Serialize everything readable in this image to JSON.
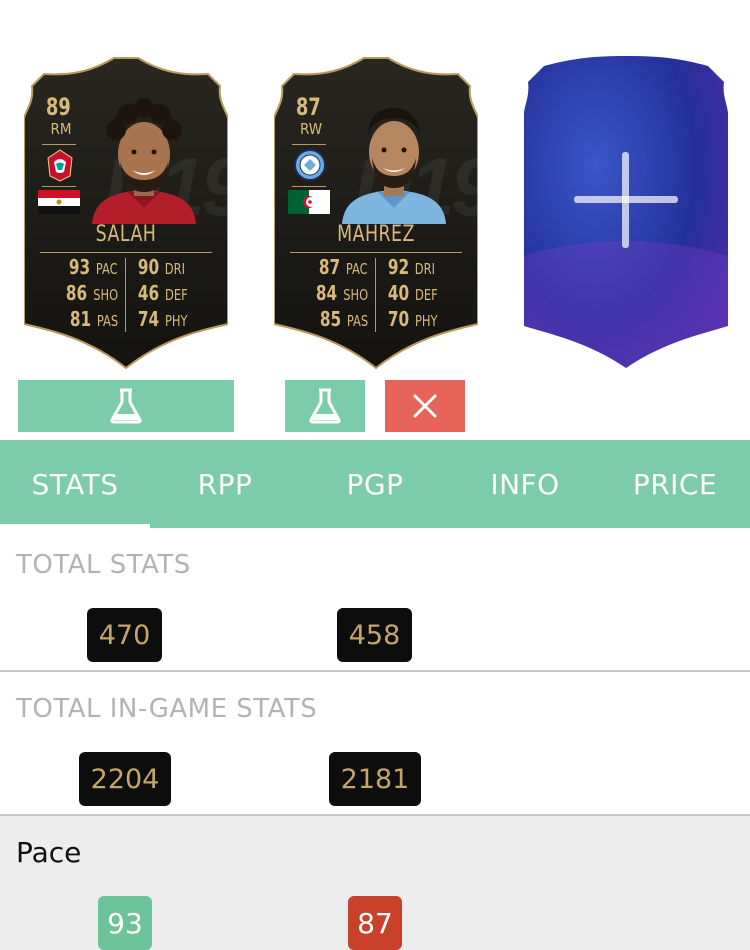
{
  "players": [
    {
      "rating": "89",
      "position": "RM",
      "name": "SALAH",
      "club_icon": "liverpool-crest-icon",
      "flag_icon": "egypt-flag-icon",
      "stats_left": [
        {
          "value": "93",
          "key": "PAC"
        },
        {
          "value": "86",
          "key": "SHO"
        },
        {
          "value": "81",
          "key": "PAS"
        }
      ],
      "stats_right": [
        {
          "value": "90",
          "key": "DRI"
        },
        {
          "value": "46",
          "key": "DEF"
        },
        {
          "value": "74",
          "key": "PHY"
        }
      ]
    },
    {
      "rating": "87",
      "position": "RW",
      "name": "MAHREZ",
      "club_icon": "man-city-crest-icon",
      "flag_icon": "algeria-flag-icon",
      "stats_left": [
        {
          "value": "87",
          "key": "PAC"
        },
        {
          "value": "84",
          "key": "SHO"
        },
        {
          "value": "85",
          "key": "PAS"
        }
      ],
      "stats_right": [
        {
          "value": "92",
          "key": "DRI"
        },
        {
          "value": "40",
          "key": "DEF"
        },
        {
          "value": "70",
          "key": "PHY"
        }
      ]
    }
  ],
  "add_slot_icon": "plus-icon",
  "actions": {
    "lab_icon": "flask-icon",
    "remove_icon": "close-icon"
  },
  "tabs": [
    {
      "label": "STATS",
      "active": true
    },
    {
      "label": "RPP",
      "active": false
    },
    {
      "label": "PGP",
      "active": false
    },
    {
      "label": "INFO",
      "active": false
    },
    {
      "label": "PRICE",
      "active": false
    }
  ],
  "sections": {
    "total_stats": {
      "title": "TOTAL STATS",
      "values": [
        "470",
        "458"
      ]
    },
    "total_ingame_stats": {
      "title": "TOTAL IN-GAME STATS",
      "values": [
        "2204",
        "2181"
      ]
    },
    "pace": {
      "title": "Pace",
      "values": [
        "93",
        "87"
      ]
    }
  },
  "colors": {
    "accent_green": "#7ccbab",
    "remove_red": "#e7645a",
    "better_green": "#6cc39a",
    "worse_red": "#c9412b",
    "card_gold": "#d9b97a",
    "card_black": "#1a1915"
  }
}
